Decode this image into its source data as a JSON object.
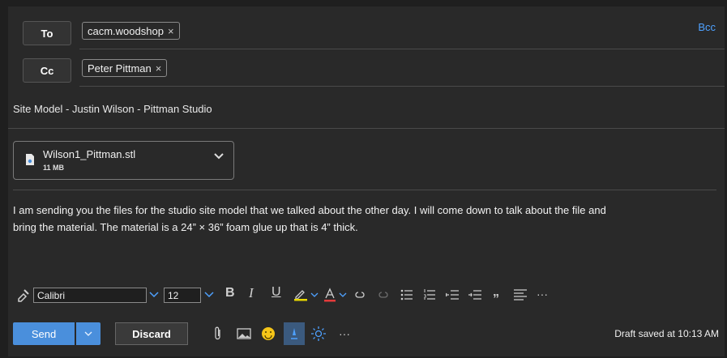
{
  "header": {
    "to_label": "To",
    "cc_label": "Cc",
    "bcc_label": "Bcc",
    "to_recipients": [
      "cacm.woodshop"
    ],
    "cc_recipients": [
      "Peter Pittman"
    ],
    "remove_glyph": "×"
  },
  "subject": "Site Model - Justin Wilson - Pittman Studio",
  "attachment": {
    "name": "Wilson1_Pittman.stl",
    "size": "11 MB",
    "icon": "file-icon"
  },
  "body": {
    "line1": "I am sending you the files for the studio site model that we talked about the other day. I will come down to talk about the file and",
    "line2": "bring the material. The material is a 24” × 36” foam glue up that is 4” thick."
  },
  "format_toolbar": {
    "font_name": "Calibri",
    "font_size": "12",
    "bold": "B",
    "italic": "I",
    "underline": "U",
    "quote": "„",
    "more": "···"
  },
  "bottom_bar": {
    "send_label": "Send",
    "discard_label": "Discard",
    "more": "···",
    "draft_status": "Draft saved at 10:13 AM"
  },
  "colors": {
    "accent": "#4a8fdc",
    "link": "#4ea1ff",
    "background": "#292929"
  }
}
